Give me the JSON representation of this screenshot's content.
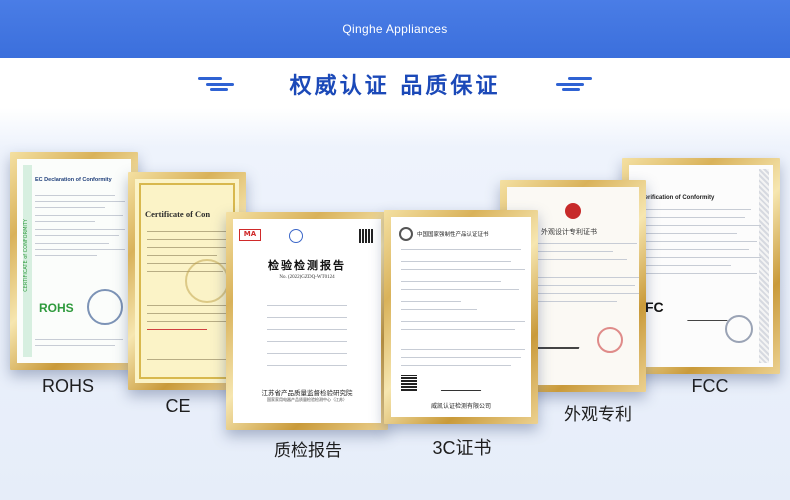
{
  "header": {
    "brand": "Qinghe Appliances"
  },
  "section": {
    "title": "权威认证 品质保证"
  },
  "certificates": [
    {
      "caption": "ROHS",
      "heading": "EC Declaration of Conformity",
      "mark": "ROHS",
      "side_text": "CERTIFICATE of CONFORMITY"
    },
    {
      "caption": "CE",
      "heading": "Certificate of Con"
    },
    {
      "caption": "质检报告",
      "heading": "检验检测报告",
      "report_no": "No. (2022)GZDQ-WT0124",
      "issuer_line1": "江苏省产品质量监督检验研究院",
      "issuer_line2": "国家家用电器产品质量检验检测中心（江苏）"
    },
    {
      "caption": "3C证书",
      "heading": "中国国家强制性产品认证证书",
      "issuer": "威凯认证检测有限公司"
    },
    {
      "caption": "外观专利",
      "heading": "外观设计专利证书"
    },
    {
      "caption": "FCC",
      "heading": "Verification of Conformity",
      "mark": "FC"
    }
  ],
  "colors": {
    "header_bg": "#3b6fdc",
    "title": "#1b49b8",
    "gold": "#d9b25a",
    "rohs_green": "#2e9a3c"
  }
}
